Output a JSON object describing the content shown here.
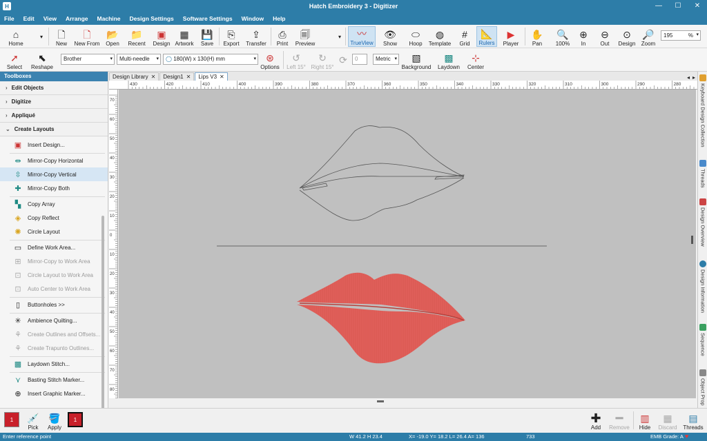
{
  "window": {
    "title": "Hatch Embroidery 3 - Digitizer",
    "app_icon": "H"
  },
  "menu": [
    "File",
    "Edit",
    "View",
    "Arrange",
    "Machine",
    "Design Settings",
    "Software Settings",
    "Window",
    "Help"
  ],
  "toolbar1": {
    "home": "Home",
    "new": "New",
    "new_from": "New From",
    "open": "Open",
    "recent": "Recent",
    "design": "Design",
    "artwork": "Artwork",
    "save": "Save",
    "export": "Export",
    "transfer": "Transfer",
    "print": "Print",
    "preview": "Preview",
    "trueview": "TrueView",
    "show": "Show",
    "hoop": "Hoop",
    "template": "Template",
    "grid": "Grid",
    "rulers": "Rulers",
    "player": "Player",
    "pan": "Pan",
    "zoom100": "100%",
    "zoom_in": "In",
    "zoom_out": "Out",
    "zoom_design": "Design",
    "zoom": "Zoom",
    "zoom_value": "195",
    "zoom_unit": "%"
  },
  "toolbar2": {
    "select": "Select",
    "reshape": "Reshape",
    "machine": "Brother",
    "needle": "Multi-needle",
    "hoop_size": "180(W) x 130(H) mm",
    "options": "Options",
    "left15": "Left 15°",
    "right15": "Right 15°",
    "angle_value": "0",
    "units": "Metric",
    "background": "Background",
    "laydown": "Laydown",
    "center": "Center"
  },
  "toolboxes": {
    "header": "Toolboxes",
    "sections": [
      "Edit Objects",
      "Digitize",
      "Appliqué",
      "Create Layouts"
    ],
    "items": [
      {
        "label": "Insert Design...",
        "disabled": false
      },
      {
        "label": "Mirror-Copy Horizontal",
        "disabled": false
      },
      {
        "label": "Mirror-Copy Vertical",
        "disabled": false,
        "selected": true
      },
      {
        "label": "Mirror-Copy Both",
        "disabled": false
      },
      {
        "label": "Copy Array",
        "disabled": false
      },
      {
        "label": "Copy Reflect",
        "disabled": false
      },
      {
        "label": "Circle Layout",
        "disabled": false
      },
      {
        "label": "Define Work Area...",
        "disabled": false
      },
      {
        "label": "Mirror-Copy to Work Area",
        "disabled": true
      },
      {
        "label": "Circle Layout to Work Area",
        "disabled": true
      },
      {
        "label": "Auto Center to Work Area",
        "disabled": true
      },
      {
        "label": "Buttonholes >>",
        "disabled": false
      },
      {
        "label": "Ambience Quilting...",
        "disabled": false
      },
      {
        "label": "Create Outlines and Offsets...",
        "disabled": true
      },
      {
        "label": "Create Trapunto Outlines...",
        "disabled": true
      },
      {
        "label": "Laydown Stitch...",
        "disabled": false
      },
      {
        "label": "Basting Stitch Marker...",
        "disabled": false
      },
      {
        "label": "Insert Graphic Marker...",
        "disabled": false
      }
    ]
  },
  "tabs": [
    "Design Library",
    "Design1",
    "Lips V3"
  ],
  "ruler_h": [
    "430",
    "420",
    "410",
    "400",
    "390",
    "380",
    "370",
    "360",
    "350",
    "340",
    "330",
    "320",
    "310",
    "300",
    "290",
    "280"
  ],
  "ruler_v": [
    "70",
    "60",
    "50",
    "40",
    "30",
    "20",
    "10",
    "0",
    "10",
    "20",
    "30",
    "40",
    "50",
    "60",
    "70",
    "80"
  ],
  "right_dock": [
    "Keyboard Design Collection",
    "Threads",
    "Design Overview",
    "Design Information",
    "Sequence",
    "Object Prop"
  ],
  "bottom_toolbar": {
    "pick": "Pick",
    "apply": "Apply",
    "thread_num": "1",
    "add": "Add",
    "remove": "Remove",
    "hide": "Hide",
    "discard": "Discard",
    "threads": "Threads"
  },
  "status": {
    "hint": "Enter reference point",
    "size": "W  41.2 H  23.4",
    "coords": "X=  -19.0 Y=   18.2 L=   26.4 A=  136",
    "stitches": "733",
    "grade": "EMB Grade: A"
  },
  "colors": {
    "titlebar": "#2d7da8",
    "lips_fill": "#e05f5a",
    "canvas": "#c0c0c0"
  }
}
